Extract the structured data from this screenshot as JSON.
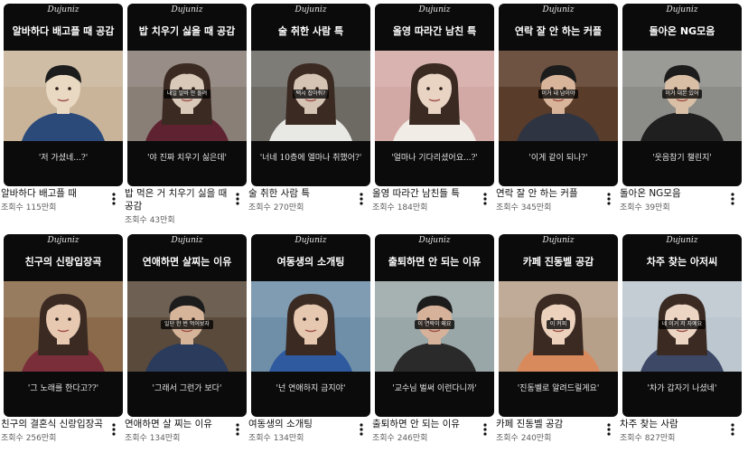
{
  "channel_logo": "Dujuniz",
  "views_prefix": "조회수",
  "videos": [
    {
      "thumb_title": "알바하다 배고플 때 공감",
      "subtitle": "",
      "quote": "'저 가셨네...?'",
      "title": "알바하다 배고플 때",
      "views": "조회수 115만회",
      "palette": [
        "#c9b49a",
        "#e9d8c2",
        "#2b4a7a"
      ]
    },
    {
      "thumb_title": "밥 치우기 싫을 때 공감",
      "subtitle": "내일 알바 안 돌려",
      "quote": "'야 진짜 치우기 싫은데'",
      "title": "밥 먹은 거 치우기 싫을 때 공감",
      "views": "조회수 43만회",
      "palette": [
        "#8a7f77",
        "#d9c9b8",
        "#5e2230"
      ]
    },
    {
      "thumb_title": "술 취한 사람 특",
      "subtitle": "택시 잡아줘?",
      "quote": "'너네 10층에 엘마나 취했어?'",
      "title": "술 취한 사람 특",
      "views": "조회수 270만회",
      "palette": [
        "#6d6a64",
        "#d5c4b4",
        "#e8e8e4"
      ]
    },
    {
      "thumb_title": "올영 따라간 남친 특",
      "subtitle": "",
      "quote": "'얼마나 기다리셨어요...?'",
      "title": "올영 따라간 남친들 특",
      "views": "조회수 184만회",
      "palette": [
        "#d3a9a5",
        "#e9d4c4",
        "#f1ece6"
      ]
    },
    {
      "thumb_title": "연락 잘 안 하는 커플",
      "subtitle": "이거 내 남이야",
      "quote": "'이게 같이 되나?'",
      "title": "연락 잘 안 하는 커플",
      "views": "조회수 345만회",
      "palette": [
        "#5a3c2a",
        "#d8b59a",
        "#2f3442"
      ]
    },
    {
      "thumb_title": "돌아온 NG모음",
      "subtitle": "이거 대본 있어",
      "quote": "'웃음참기 챌린지'",
      "title": "돌아온 NG모음",
      "views": "조회수 39만회",
      "palette": [
        "#8c8c88",
        "#d8bfa6",
        "#1f1f1f"
      ]
    },
    {
      "thumb_title": "친구의 신랑입장곡",
      "subtitle": "",
      "quote": "'그 노래를 한다고??'",
      "title": "친구의 결혼식 신랑입장곡",
      "views": "조회수 256만회",
      "palette": [
        "#8a6a4a",
        "#e7c9b1",
        "#7a2e3a"
      ]
    },
    {
      "thumb_title": "연애하면 살찌는 이유",
      "subtitle": "일단 한 번 먹어보자",
      "quote": "'그래서 그런가 보다'",
      "title": "연애하면 살 찌는 이유",
      "views": "조회수 134만회",
      "palette": [
        "#5a4a3c",
        "#d6b49a",
        "#2a3b5c"
      ]
    },
    {
      "thumb_title": "여동생의 소개팅",
      "subtitle": "",
      "quote": "'넌 연애하지 금지야'",
      "title": "여동생의 소개팅",
      "views": "조회수 134만회",
      "palette": [
        "#6f8fa8",
        "#e6c8b0",
        "#2f5aa0"
      ]
    },
    {
      "thumb_title": "출퇴하면 안 되는 이유",
      "subtitle": "이 연락이 왜요",
      "quote": "'교수님 벌써 이런다니까'",
      "title": "출퇴하면 안 되는 이유",
      "views": "조회수 246만회",
      "palette": [
        "#9aa7a8",
        "#d6b29a",
        "#2a2a2a"
      ]
    },
    {
      "thumb_title": "카페 진동벨 공감",
      "subtitle": "이 커피",
      "quote": "'진동벨로 알려드릴게요'",
      "title": "카페 진동벨 공감",
      "views": "조회수 240만회",
      "palette": [
        "#b7a08a",
        "#ecd2bd",
        "#d98a5c"
      ]
    },
    {
      "thumb_title": "차주 찾는 아저씨",
      "subtitle": "네 이거 저 차예요",
      "quote": "'차가 갑자기 나셨네'",
      "title": "차주 찾는 사람",
      "views": "조회수 827만회",
      "palette": [
        "#bcc7cf",
        "#ecd5c3",
        "#3c4866"
      ]
    }
  ]
}
